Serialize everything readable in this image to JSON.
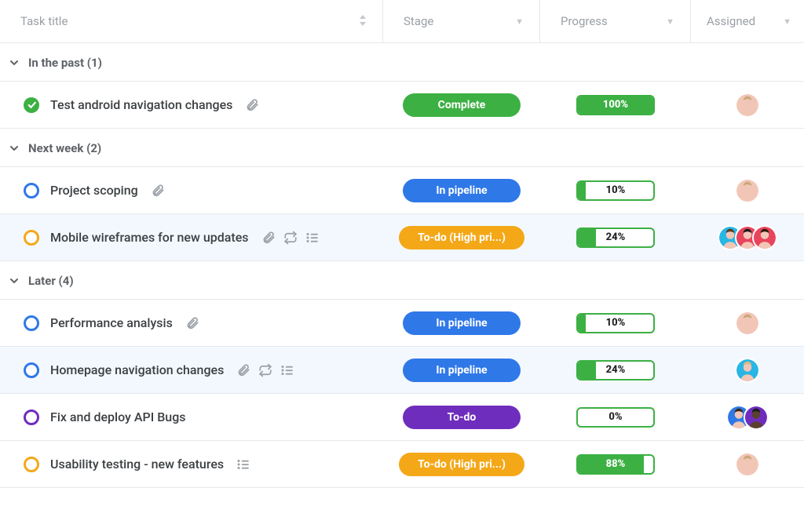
{
  "columns": {
    "title": "Task title",
    "stage": "Stage",
    "progress": "Progress",
    "assigned": "Assigned"
  },
  "groups": [
    {
      "label": "In the past (1)",
      "rows": [
        {
          "status": "done",
          "title": "Test android navigation changes",
          "icons": [
            "attachment"
          ],
          "stage": {
            "label": "Complete",
            "color": "green"
          },
          "progress": {
            "value": 100,
            "label": "100%",
            "full": true
          },
          "avatars": [
            {
              "bg": "#f2c6b6",
              "hair": "#caa87a"
            }
          ]
        }
      ]
    },
    {
      "label": "Next week (2)",
      "rows": [
        {
          "status": "ring",
          "ring": "#2f78e8",
          "title": "Project scoping",
          "icons": [
            "attachment"
          ],
          "stage": {
            "label": "In pipeline",
            "color": "blue"
          },
          "progress": {
            "value": 10,
            "label": "10%"
          },
          "avatars": [
            {
              "bg": "#f2c6b6",
              "hair": "#caa87a"
            }
          ]
        },
        {
          "status": "ring",
          "ring": "#f4a818",
          "highlight": true,
          "title": "Mobile wireframes for new updates",
          "icons": [
            "attachment",
            "repeat",
            "list"
          ],
          "stage": {
            "label": "To-do (High pri...)",
            "color": "orange"
          },
          "progress": {
            "value": 24,
            "label": "24%"
          },
          "avatars": [
            {
              "bg": "#28b6e4",
              "hair": "#5a3b1e"
            },
            {
              "bg": "#e8455c",
              "hair": "#1a1a1a"
            },
            {
              "bg": "#e8455c",
              "hair": "#2d1b0c"
            }
          ]
        }
      ]
    },
    {
      "label": "Later (4)",
      "rows": [
        {
          "status": "ring",
          "ring": "#2f78e8",
          "title": "Performance analysis",
          "icons": [
            "attachment"
          ],
          "stage": {
            "label": "In pipeline",
            "color": "blue"
          },
          "progress": {
            "value": 10,
            "label": "10%"
          },
          "avatars": [
            {
              "bg": "#f2c6b6",
              "hair": "#caa87a"
            }
          ]
        },
        {
          "status": "ring",
          "ring": "#2f78e8",
          "highlight": true,
          "title": "Homepage navigation changes",
          "icons": [
            "attachment",
            "repeat",
            "list"
          ],
          "stage": {
            "label": "In pipeline",
            "color": "blue"
          },
          "progress": {
            "value": 24,
            "label": "24%"
          },
          "avatars": [
            {
              "bg": "#28b6e4",
              "hair": "#d6b88a"
            }
          ]
        },
        {
          "status": "ring",
          "ring": "#6f2dbd",
          "title": "Fix and deploy API Bugs",
          "icons": [],
          "stage": {
            "label": "To-do",
            "color": "purple"
          },
          "progress": {
            "value": 0,
            "label": "0%"
          },
          "avatars": [
            {
              "bg": "#2f78e8",
              "hair": "#3a2a15"
            },
            {
              "bg": "#6f2dbd",
              "hair": "#1c1c1c",
              "skin": "#5a4030"
            }
          ]
        },
        {
          "status": "ring",
          "ring": "#f4a818",
          "title": "Usability testing - new features",
          "icons": [
            "list"
          ],
          "stage": {
            "label": "To-do (High pri...)",
            "color": "orange"
          },
          "progress": {
            "value": 88,
            "label": "88%",
            "full": true
          },
          "avatars": [
            {
              "bg": "#f2c6b6",
              "hair": "#caa87a"
            }
          ]
        }
      ]
    }
  ]
}
